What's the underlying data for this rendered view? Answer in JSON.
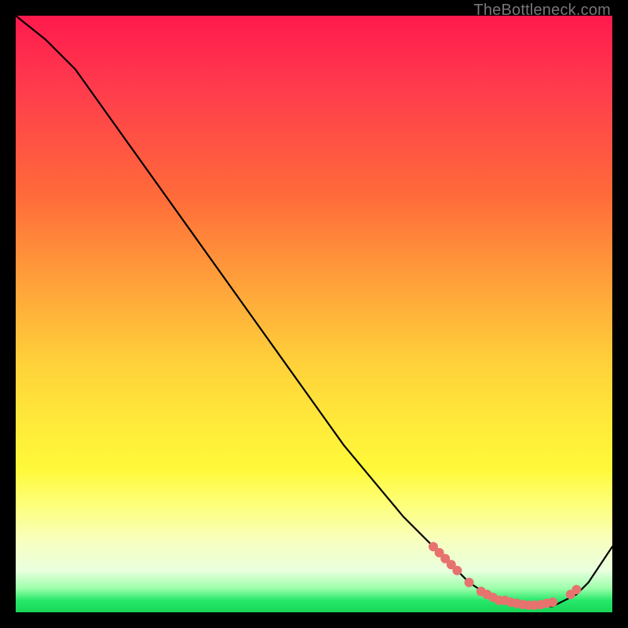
{
  "attribution": "TheBottleneck.com",
  "chart_data": {
    "type": "line",
    "title": "",
    "xlabel": "",
    "ylabel": "",
    "xlim": [
      0,
      100
    ],
    "ylim": [
      0,
      100
    ],
    "series": [
      {
        "name": "curve",
        "x": [
          0,
          5,
          10,
          15,
          20,
          25,
          30,
          35,
          40,
          45,
          50,
          55,
          60,
          65,
          70,
          73,
          76,
          79,
          82,
          85,
          88,
          90,
          92,
          94,
          96,
          98,
          100
        ],
        "y": [
          100,
          96,
          91,
          84,
          77,
          70,
          63,
          56,
          49,
          42,
          35,
          28,
          22,
          16,
          11,
          8,
          5,
          3,
          2,
          1,
          1,
          1,
          2,
          3,
          5,
          8,
          11
        ]
      }
    ],
    "markers": {
      "name": "highlight-dots",
      "points": [
        {
          "x": 70,
          "y": 11
        },
        {
          "x": 71,
          "y": 10
        },
        {
          "x": 72,
          "y": 9
        },
        {
          "x": 73,
          "y": 8
        },
        {
          "x": 74,
          "y": 7
        },
        {
          "x": 76,
          "y": 5
        },
        {
          "x": 78,
          "y": 3.5
        },
        {
          "x": 79,
          "y": 3
        },
        {
          "x": 80,
          "y": 2.5
        },
        {
          "x": 81,
          "y": 2
        },
        {
          "x": 82,
          "y": 2
        },
        {
          "x": 83,
          "y": 1.7
        },
        {
          "x": 84,
          "y": 1.5
        },
        {
          "x": 85,
          "y": 1.3
        },
        {
          "x": 86,
          "y": 1.2
        },
        {
          "x": 87,
          "y": 1.2
        },
        {
          "x": 88,
          "y": 1.3
        },
        {
          "x": 89,
          "y": 1.5
        },
        {
          "x": 90,
          "y": 1.7
        },
        {
          "x": 93,
          "y": 3
        },
        {
          "x": 94,
          "y": 3.8
        }
      ]
    }
  }
}
